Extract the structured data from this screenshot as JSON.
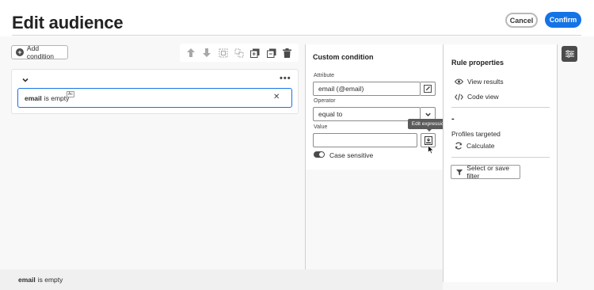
{
  "header": {
    "title": "Edit audience",
    "cancel_label": "Cancel",
    "confirm_label": "Confirm"
  },
  "canvas": {
    "add_condition_label": "Add condition",
    "condition": {
      "attribute": "email",
      "operator": "is empty",
      "badge": "Ac"
    },
    "toolbar_icons": [
      "arrow-up-icon",
      "arrow-down-icon",
      "group-icon",
      "ungroup-icon",
      "copy-icon",
      "duplicate-icon",
      "trash-icon"
    ]
  },
  "custom_condition": {
    "title": "Custom condition",
    "attribute_label": "Attribute",
    "attribute_value": "email (@email)",
    "operator_label": "Operator",
    "operator_value": "equal to",
    "value_label": "Value",
    "value_value": "",
    "case_sensitive_label": "Case sensitive",
    "case_sensitive": true,
    "tooltip": "Edit expression"
  },
  "rule_properties": {
    "title": "Rule properties",
    "view_results": "View results",
    "code_view": "Code view",
    "count": "-",
    "profiles_targeted": "Profiles targeted",
    "calculate": "Calculate",
    "filter_button": "Select or save filter"
  },
  "footer": {
    "attribute": "email",
    "operator": "is empty"
  },
  "colors": {
    "accent": "#1473e6",
    "dark": "#4b4b4b"
  }
}
